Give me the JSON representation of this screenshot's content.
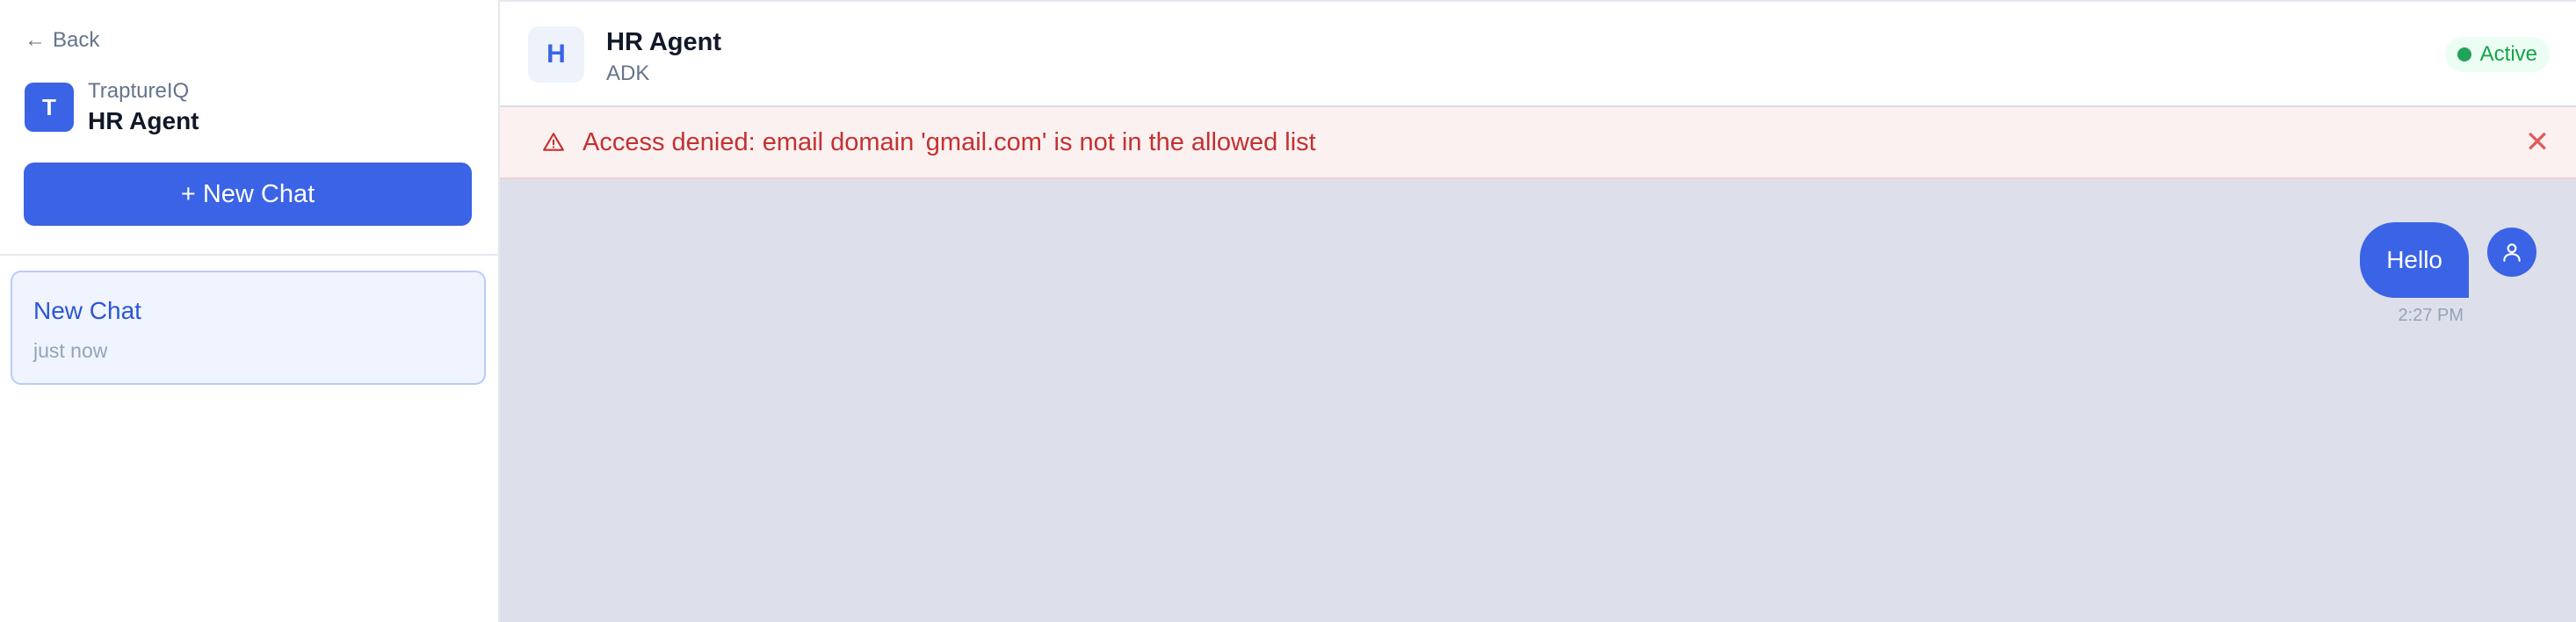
{
  "sidebar": {
    "back_label": "Back",
    "brand": {
      "initial": "T",
      "org": "TraptureIQ",
      "name": "HR Agent"
    },
    "new_chat_label": "+ New Chat",
    "chats": [
      {
        "title": "New Chat",
        "time": "just now"
      }
    ]
  },
  "header": {
    "agent_initial": "H",
    "agent_name": "HR Agent",
    "agent_sub": "ADK",
    "status": "Active"
  },
  "alert": {
    "message": "Access denied: email domain 'gmail.com' is not in the allowed list",
    "close_symbol": "✕"
  },
  "messages": [
    {
      "sender": "user",
      "text": "Hello",
      "time": "2:27 PM"
    }
  ],
  "colors": {
    "accent": "#3a63e6",
    "alert_text": "#c53030",
    "alert_bg": "#fcf1f1",
    "status_green": "#22a35a",
    "chat_bg": "#dde0ea"
  },
  "icons": {
    "back": "arrow-left-icon",
    "alert": "warning-triangle-icon",
    "close": "close-icon",
    "user": "user-icon"
  }
}
